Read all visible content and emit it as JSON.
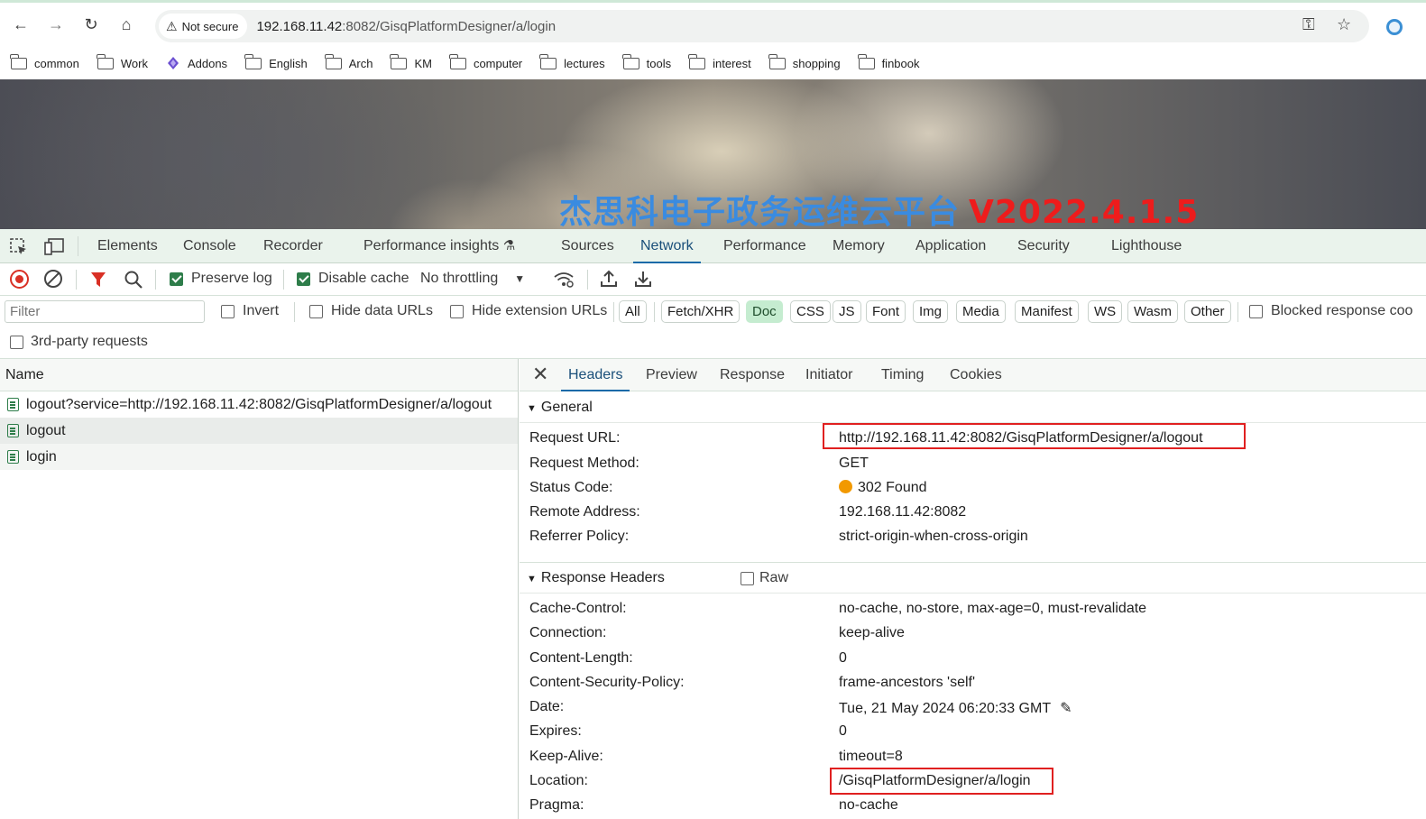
{
  "browser": {
    "not_secure_label": "Not secure",
    "url_host": "192.168.11.42",
    "url_rest": ":8082/GisqPlatformDesigner/a/login",
    "bookmarks": [
      "common",
      "Work",
      "Addons",
      "English",
      "Arch",
      "KM",
      "computer",
      "lectures",
      "tools",
      "interest",
      "shopping",
      "finbook"
    ]
  },
  "page": {
    "banner_title_cn": "杰思科电子政务运维云平台",
    "banner_version": "V2022.4.1.5"
  },
  "devtools": {
    "tabs": [
      "Elements",
      "Console",
      "Recorder",
      "Performance insights",
      "Sources",
      "Network",
      "Performance",
      "Memory",
      "Application",
      "Security",
      "Lighthouse"
    ],
    "active_tab": "Network",
    "toolbar": {
      "preserve_log": "Preserve log",
      "disable_cache": "Disable cache",
      "throttling": "No throttling"
    },
    "filter": {
      "placeholder": "Filter",
      "invert": "Invert",
      "hide_data_urls": "Hide data URLs",
      "hide_extension_urls": "Hide extension URLs",
      "types": [
        "All",
        "Fetch/XHR",
        "Doc",
        "CSS",
        "JS",
        "Font",
        "Img",
        "Media",
        "Manifest",
        "WS",
        "Wasm",
        "Other"
      ],
      "active_type": "Doc",
      "blocked_response": "Blocked response coo",
      "third_party": "3rd-party requests"
    },
    "requests": {
      "column": "Name",
      "rows": [
        "logout?service=http://192.168.11.42:8082/GisqPlatformDesigner/a/logout",
        "logout",
        "login"
      ]
    },
    "details": {
      "tabs": [
        "Headers",
        "Preview",
        "Response",
        "Initiator",
        "Timing",
        "Cookies"
      ],
      "general_title": "General",
      "general": [
        {
          "key": "Request URL:",
          "value": "http://192.168.11.42:8082/GisqPlatformDesigner/a/logout"
        },
        {
          "key": "Request Method:",
          "value": "GET"
        },
        {
          "key": "Status Code:",
          "value": "302 Found"
        },
        {
          "key": "Remote Address:",
          "value": "192.168.11.42:8082"
        },
        {
          "key": "Referrer Policy:",
          "value": "strict-origin-when-cross-origin"
        }
      ],
      "response_title": "Response Headers",
      "raw_label": "Raw",
      "response": [
        {
          "key": "Cache-Control:",
          "value": "no-cache, no-store, max-age=0, must-revalidate"
        },
        {
          "key": "Connection:",
          "value": "keep-alive"
        },
        {
          "key": "Content-Length:",
          "value": "0"
        },
        {
          "key": "Content-Security-Policy:",
          "value": "frame-ancestors 'self'"
        },
        {
          "key": "Date:",
          "value": "Tue, 21 May 2024 06:20:33 GMT"
        },
        {
          "key": "Expires:",
          "value": "0"
        },
        {
          "key": "Keep-Alive:",
          "value": "timeout=8"
        },
        {
          "key": "Location:",
          "value": "/GisqPlatformDesigner/a/login"
        },
        {
          "key": "Pragma:",
          "value": "no-cache"
        }
      ]
    }
  }
}
